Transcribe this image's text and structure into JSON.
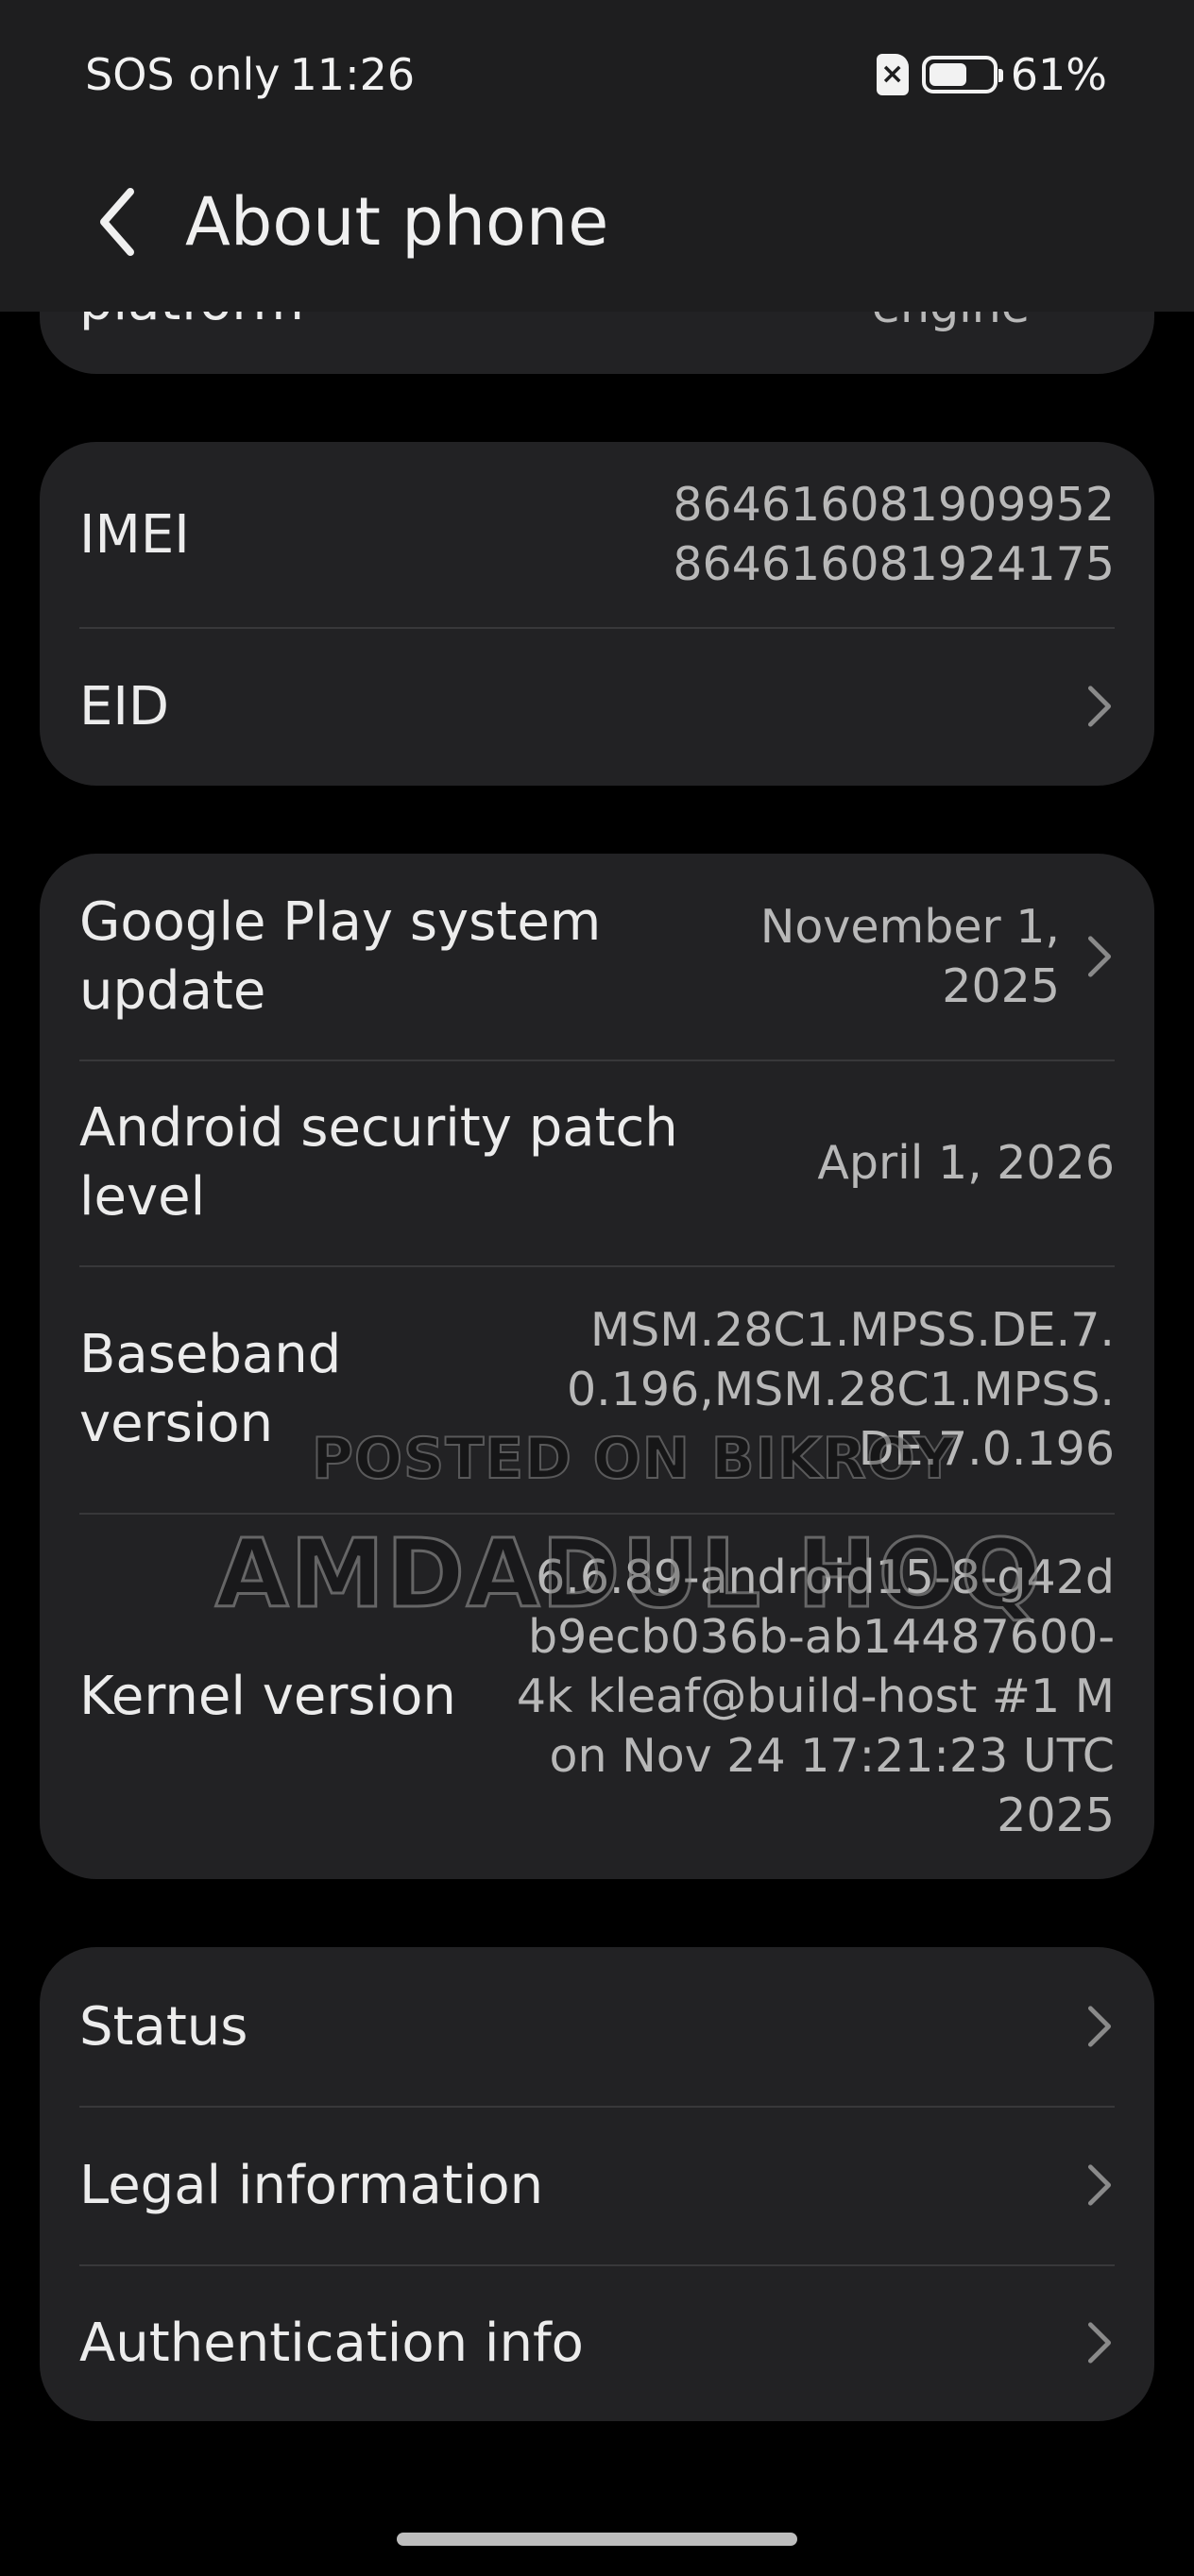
{
  "status_bar": {
    "carrier": "SOS only",
    "time": "11:26",
    "battery": "61%",
    "battery_level": 0.61
  },
  "header": {
    "title": "About phone"
  },
  "partial_card": {
    "label": "platform",
    "value": "engine"
  },
  "imei_card": {
    "imei_label": "IMEI",
    "imei_values": [
      "864616081909952",
      "864616081924175"
    ],
    "eid_label": "EID"
  },
  "system_card": {
    "play_update_label": "Google Play system update",
    "play_update_value": "November 1, 2025",
    "security_patch_label": "Android security patch level",
    "security_patch_value": "April 1, 2026",
    "baseband_label": "Baseband version",
    "baseband_value": "MSM.28C1.MPSS.DE.7.0.196,MSM.28C1.MPSS.DE.7.0.196",
    "kernel_label": "Kernel version",
    "kernel_value": "6.6.89-android15-8-g42db9ecb036b-ab14487600-4k kleaf@build-host #1 Mon Nov 24 17:21:23 UTC 2025"
  },
  "more_card": {
    "status_label": "Status",
    "legal_label": "Legal information",
    "auth_label": "Authentication info"
  },
  "watermark": {
    "line1": "POSTED ON BIKROY",
    "line2": "AMDADUL HOQ"
  },
  "colors": {
    "background": "#000000",
    "header": "#1e1e1f",
    "card": "#222224",
    "primary_text": "#ececec",
    "secondary_text": "#b8b8b8"
  }
}
